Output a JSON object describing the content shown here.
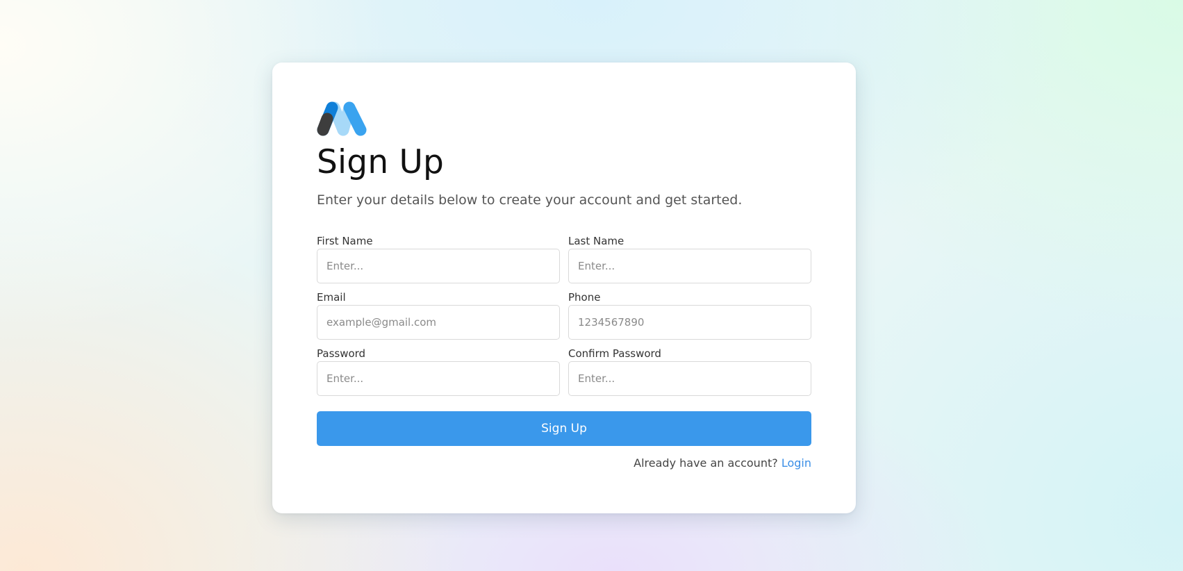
{
  "brand": {
    "logo_icon": "m-logo-icon",
    "colors": {
      "dark": "#3d3d3d",
      "blue": "#0f7fd8",
      "light_blue": "#a7d9f8",
      "accent": "#3a98eb"
    }
  },
  "header": {
    "title": "Sign Up",
    "subtitle": "Enter your details below to create your account and get started."
  },
  "form": {
    "first_name": {
      "label": "First Name",
      "placeholder": "Enter...",
      "value": ""
    },
    "last_name": {
      "label": "Last Name",
      "placeholder": "Enter...",
      "value": ""
    },
    "email": {
      "label": "Email",
      "placeholder": "example@gmail.com",
      "value": ""
    },
    "phone": {
      "label": "Phone",
      "placeholder": "1234567890",
      "value": ""
    },
    "password": {
      "label": "Password",
      "placeholder": "Enter...",
      "value": ""
    },
    "confirm_password": {
      "label": "Confirm Password",
      "placeholder": "Enter...",
      "value": ""
    },
    "submit_label": "Sign Up"
  },
  "footer": {
    "prompt": "Already have an account?",
    "login_label": "Login"
  }
}
